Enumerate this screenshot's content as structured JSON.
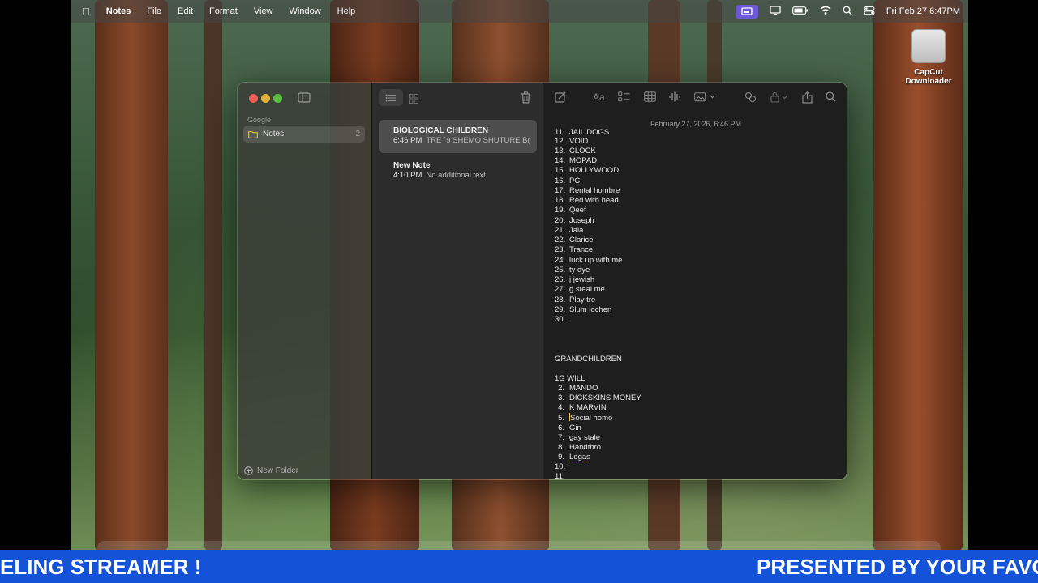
{
  "menubar": {
    "app_name": "Notes",
    "menus": [
      "File",
      "Edit",
      "Format",
      "View",
      "Window",
      "Help"
    ],
    "clock": "Fri Feb 27  6:47PM"
  },
  "desktop_icon": {
    "label": "CapCut Downloader"
  },
  "sidebar": {
    "section": "Google",
    "folder_label": "Notes",
    "folder_count": "2",
    "new_folder_label": "New Folder"
  },
  "notes": [
    {
      "title": "BIOLOGICAL CHILDREN",
      "time": "6:46 PM",
      "preview": "TRE `9 SHEMO SHUTURE B("
    },
    {
      "title": "New Note",
      "time": "4:10 PM",
      "preview": "No additional text"
    }
  ],
  "editor": {
    "date": "February 27, 2026, 6:46 PM",
    "list1": [
      {
        "n": "11.",
        "t": "JAIL DOGS"
      },
      {
        "n": "12.",
        "t": "VOID"
      },
      {
        "n": "13.",
        "t": "CLOCK"
      },
      {
        "n": "14.",
        "t": "MOPAD"
      },
      {
        "n": "15.",
        "t": "HOLLYWOOD"
      },
      {
        "n": "16.",
        "t": "PC"
      },
      {
        "n": "17.",
        "t": "Rental hombre"
      },
      {
        "n": "18.",
        "t": "Red with head"
      },
      {
        "n": "19.",
        "t": "Qeef"
      },
      {
        "n": "20.",
        "t": "Joseph"
      },
      {
        "n": "21.",
        "t": "Jala"
      },
      {
        "n": "22.",
        "t": "Clarice"
      },
      {
        "n": "23.",
        "t": "Trance"
      },
      {
        "n": "24.",
        "t": "luck up with me"
      },
      {
        "n": "25.",
        "t": "ty dye"
      },
      {
        "n": "26.",
        "t": "j jewish"
      },
      {
        "n": "27.",
        "t": "g steal me"
      },
      {
        "n": "28.",
        "t": "Play tre"
      },
      {
        "n": "29.",
        "t": "Slum lochen"
      },
      {
        "n": "30.",
        "t": ""
      }
    ],
    "heading2": "GRANDCHILDREN",
    "line_1g": "1G WILL",
    "list2": [
      {
        "n": "2.",
        "t": "MANDO"
      },
      {
        "n": "3.",
        "t": "DICKSKINS MONEY"
      },
      {
        "n": "4.",
        "t": "K MARVIN"
      },
      {
        "n": "5.",
        "t": "Social homo"
      },
      {
        "n": "6.",
        "t": "Gin"
      },
      {
        "n": "7.",
        "t": "gay stale"
      },
      {
        "n": "8.",
        "t": "Handthro"
      },
      {
        "n": "9.",
        "t": "Legas"
      },
      {
        "n": "10.",
        "t": ""
      },
      {
        "n": "11.",
        "t": ""
      }
    ]
  },
  "banner": {
    "left_text": "ELING STREAMER !",
    "right_text": "PRESENTED BY YOUR FAVO"
  },
  "colors": {
    "accent_purple": "#6d58d8",
    "banner_blue": "#1452d8",
    "folder_yellow": "#e6c24a"
  }
}
